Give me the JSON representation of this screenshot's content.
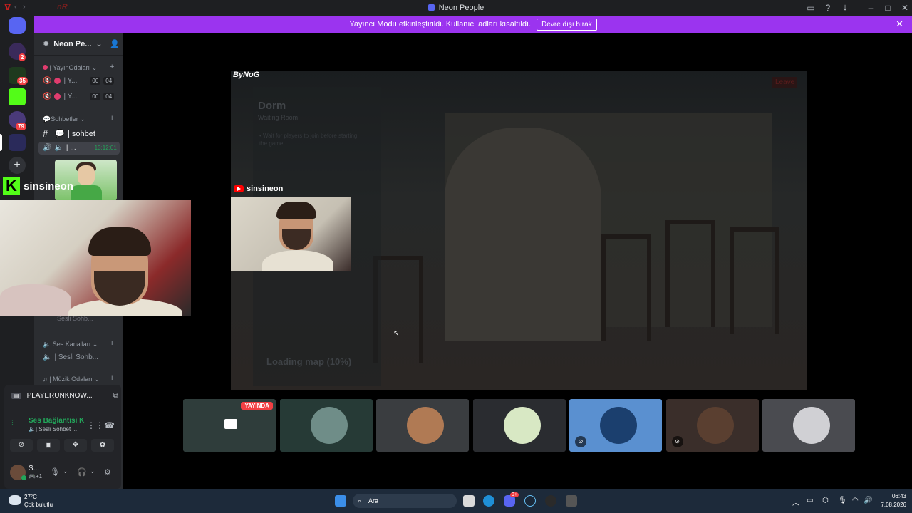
{
  "window": {
    "title": "Neon People",
    "logo_text": "nR"
  },
  "banner": {
    "message": "Yayıncı Modu etkinleştirildi. Kullanıcı adları kısaltıldı.",
    "button": "Devre dışı bırak",
    "close": "✕"
  },
  "rail": {
    "badges": [
      "2",
      "35",
      "79"
    ]
  },
  "sidebar": {
    "server_name": "Neon Pe...",
    "categories": [
      {
        "label": "| YayınOdaları"
      },
      {
        "label": "Sohbetler"
      },
      {
        "label": "Ses Kanalları"
      },
      {
        "label": "| Müzik Odaları"
      }
    ],
    "voice_rooms": [
      {
        "name": "| Y...",
        "count_a": "00",
        "count_b": "04"
      },
      {
        "name": "| Y...",
        "count_a": "00",
        "count_b": "04"
      }
    ],
    "text_channel": "| sohbet",
    "active_voice": {
      "name": "| ...",
      "timer": "13:12:01"
    },
    "partial_channel": "Sesli Sohb...",
    "ses_channel": "| Sesli Sohb..."
  },
  "overlay": {
    "kick_name": "sinsineon",
    "kick_logo": "K"
  },
  "user_panel": {
    "activity": "PLAYERUNKNOW...",
    "voice_connected": "Ses Bağlantısı K",
    "voice_channel": "| Sesli Sohbet ...",
    "user_name": "S...",
    "user_sub": "+1"
  },
  "game": {
    "brand": "ByNoG",
    "leave": "Leave",
    "room_title": "Dorm",
    "room_sub": "Waiting Room",
    "tip": "• Wait for players to join before starting the game",
    "loading": "Loading map (10%)"
  },
  "stream": {
    "streamer": "sinsineon"
  },
  "tiles": [
    {
      "live": "YAYINDA",
      "bg": "#2f3d3b"
    },
    {
      "bg": "#263a36",
      "av": "#6f8d88"
    },
    {
      "bg": "#3a3d40",
      "av": "#b07a54"
    },
    {
      "bg": "#2a2c30",
      "av": "#d8e8c4"
    },
    {
      "bg": "#5a90d0",
      "av": "#1b3f6e"
    },
    {
      "bg": "#3a2e2a",
      "av": "#5a3f30"
    },
    {
      "bg": "#4a4b50",
      "av": "#d0d0d4"
    }
  ],
  "taskbar": {
    "temp": "27°C",
    "weather": "Çok bulutlu",
    "search": "Ara",
    "time": "06:43",
    "date": "7.08.2026",
    "discord_badge": "9+"
  }
}
